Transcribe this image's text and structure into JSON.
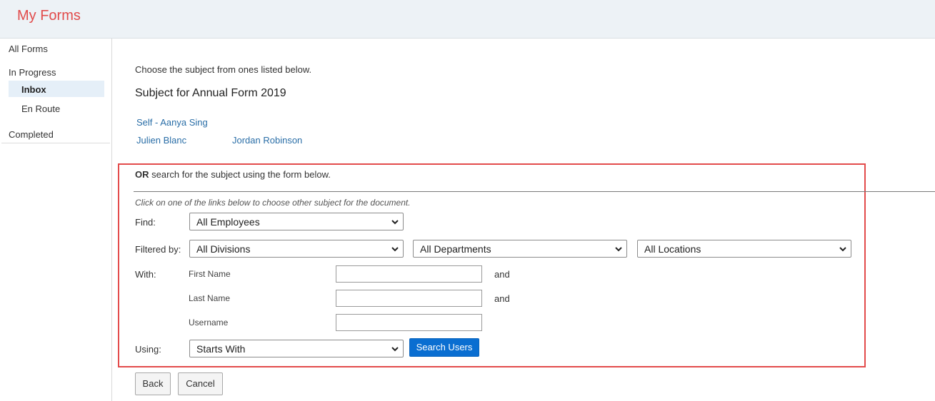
{
  "header": {
    "title": "My Forms"
  },
  "sidebar": {
    "all_forms": "All Forms",
    "in_progress": "In Progress",
    "inbox": "Inbox",
    "en_route": "En Route",
    "completed": "Completed"
  },
  "main": {
    "instruction": "Choose the subject from ones listed below.",
    "subject_heading": "Subject for Annual Form 2019",
    "subjects": [
      "Self - Aanya Sing",
      "Julien Blanc",
      "Jordan Robinson"
    ]
  },
  "search": {
    "or_bold": "OR",
    "or_rest": " search for the subject using the form below.",
    "hint": "Click on one of the links below to choose other subject for the document.",
    "find_label": "Find:",
    "find_value": "All Employees",
    "filtered_label": "Filtered by:",
    "division_value": "All Divisions",
    "department_value": "All Departments",
    "location_value": "All Locations",
    "with_label": "With:",
    "first_name_label": "First Name",
    "last_name_label": "Last Name",
    "username_label": "Username",
    "and_1": "and",
    "and_2": "and",
    "first_name_value": "",
    "last_name_value": "",
    "username_value": "",
    "using_label": "Using:",
    "using_value": "Starts With",
    "search_button": "Search Users"
  },
  "footer": {
    "back_button": "Back",
    "cancel_button": "Cancel"
  },
  "colors": {
    "title": "#e14b4b",
    "link": "#2a6ea7",
    "primary": "#0a6ed1",
    "highlight_frame": "#e34b4b"
  },
  "icons": {
    "dropdown": "chevron-down-icon"
  }
}
